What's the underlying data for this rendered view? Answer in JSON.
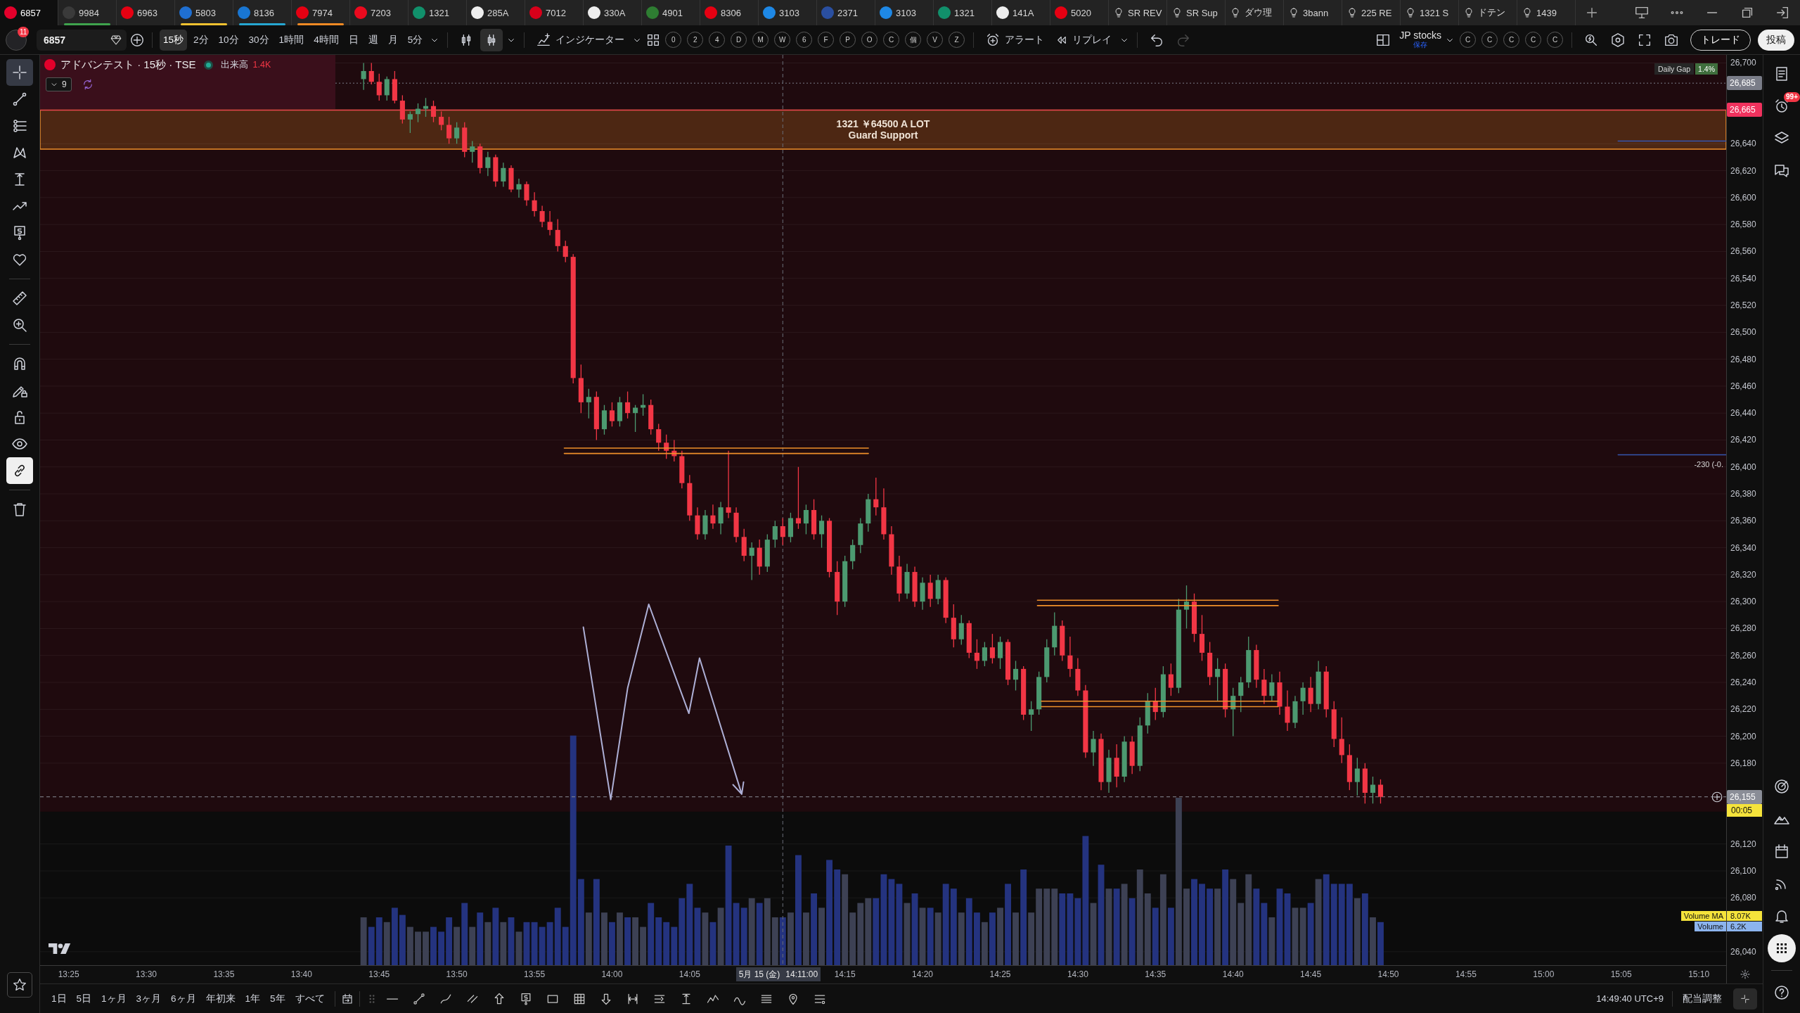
{
  "tabs": [
    {
      "label": "6857",
      "kind": "logo",
      "color": "#e4002b",
      "selected": true
    },
    {
      "label": "9984",
      "kind": "logo",
      "color": "#3a3a3a",
      "underline": {
        "color": "#3fa34d"
      },
      "selected": false
    },
    {
      "label": "6963",
      "kind": "logo",
      "color": "#e60012",
      "selected": false
    },
    {
      "label": "5803",
      "kind": "logo",
      "color": "#1f6fd1",
      "underline": {
        "color": "#f2c230"
      },
      "selected": false
    },
    {
      "label": "8136",
      "kind": "logo",
      "color": "#1976d2",
      "underline": {
        "color": "#26a6d1"
      },
      "selected": false
    },
    {
      "label": "7974",
      "kind": "logo",
      "color": "#e60012",
      "underline": {
        "color": "#f08a24"
      },
      "selected": false
    },
    {
      "label": "7203",
      "kind": "logo",
      "color": "#eb0a1e",
      "selected": false
    },
    {
      "label": "1321",
      "kind": "logo",
      "color": "#11906b",
      "selected": false
    },
    {
      "label": "285A",
      "kind": "logo",
      "color": "#eeeeee",
      "selected": false
    },
    {
      "label": "7012",
      "kind": "logo",
      "color": "#d7001a",
      "selected": false
    },
    {
      "label": "330A",
      "kind": "logo",
      "color": "#eeeeee",
      "selected": false
    },
    {
      "label": "4901",
      "kind": "logo",
      "color": "#2e7d32",
      "selected": false
    },
    {
      "label": "8306",
      "kind": "logo",
      "color": "#e60012",
      "selected": false
    },
    {
      "label": "3103",
      "kind": "logo",
      "color": "#1e88e5",
      "selected": false
    },
    {
      "label": "2371",
      "kind": "logo",
      "color": "#2a4fa0",
      "selected": false
    },
    {
      "label": "3103",
      "kind": "logo",
      "color": "#1e88e5",
      "selected": false
    },
    {
      "label": "1321",
      "kind": "logo",
      "color": "#11906b",
      "selected": false
    },
    {
      "label": "141A",
      "kind": "logo",
      "color": "#eeeeee",
      "selected": false
    },
    {
      "label": "5020",
      "kind": "logo",
      "color": "#e60012",
      "selected": false
    },
    {
      "label": "SR REV",
      "kind": "idea",
      "selected": false
    },
    {
      "label": "SR Sup",
      "kind": "idea",
      "selected": false
    },
    {
      "label": "ダウ理",
      "kind": "idea",
      "selected": false
    },
    {
      "label": "3bann",
      "kind": "idea",
      "selected": false
    },
    {
      "label": "225 RE",
      "kind": "idea",
      "selected": false
    },
    {
      "label": "1321 S",
      "kind": "idea",
      "selected": false
    },
    {
      "label": "ドテン",
      "kind": "idea",
      "selected": false
    },
    {
      "label": "1439",
      "kind": "idea",
      "selected": false
    }
  ],
  "toolbar": {
    "notifications": "11",
    "symbol": "6857",
    "intervals": [
      {
        "label": "15秒",
        "selected": true
      },
      {
        "label": "2分",
        "selected": false
      },
      {
        "label": "10分",
        "selected": false
      },
      {
        "label": "30分",
        "selected": false
      },
      {
        "label": "1時間",
        "selected": false
      },
      {
        "label": "4時間",
        "selected": false
      },
      {
        "label": "日",
        "selected": false
      },
      {
        "label": "週",
        "selected": false
      },
      {
        "label": "月",
        "selected": false
      },
      {
        "label": "5分",
        "selected": false
      }
    ],
    "chart_types": [
      {
        "kind": "bars",
        "selected": false
      },
      {
        "kind": "candles",
        "selected": true
      }
    ],
    "indicators": "インジケーター",
    "quick_buttons": [
      "0",
      "2",
      "4",
      "D",
      "M",
      "W",
      "6",
      "F",
      "P",
      "O",
      "C",
      "個",
      "V",
      "Z"
    ],
    "alert": "アラート",
    "replay": "リプレイ",
    "history": [
      {
        "kind": "undo",
        "disabled": false
      },
      {
        "kind": "redo",
        "disabled": true
      }
    ],
    "layout": {
      "name": "JP stocks",
      "status": "保存"
    },
    "layout_slots": [
      "C",
      "C",
      "C",
      "C",
      "C"
    ],
    "trade": "トレード",
    "publish": "投稿"
  },
  "left_toolbar": {
    "drawing_tools": [
      {
        "kind": "crosshair",
        "selected": true
      },
      {
        "kind": "trend-line",
        "selected": false
      },
      {
        "kind": "parallel-lines",
        "selected": false
      },
      {
        "kind": "pattern",
        "selected": false
      },
      {
        "kind": "projection",
        "selected": false
      },
      {
        "kind": "zigzag-arrow",
        "selected": false
      },
      {
        "kind": "price-note",
        "selected": false
      },
      {
        "kind": "heart",
        "selected": false
      }
    ],
    "view_tools": [
      {
        "kind": "ruler",
        "selected": false
      },
      {
        "kind": "zoom-in",
        "selected": false
      }
    ],
    "toggles": [
      {
        "kind": "magnet",
        "on": false
      },
      {
        "kind": "pencil-lock",
        "on": false
      },
      {
        "kind": "unlock",
        "on": false
      },
      {
        "kind": "eye",
        "on": false
      },
      {
        "kind": "link",
        "on": true
      }
    ],
    "actions": [
      {
        "kind": "trash"
      }
    ],
    "favorites": [
      {
        "kind": "star"
      }
    ]
  },
  "chart": {
    "legend": {
      "title": "アドバンテスト · 15秒 · TSE",
      "volume_label": "出来高",
      "volume_value": "1.4K",
      "collapse_count": "9"
    },
    "daily_gap": {
      "label": "Daily Gap",
      "value": "1.4%"
    },
    "crosshair": {
      "date": "5月 15 (金)"
    },
    "countdown": "00:05",
    "volume_legend": [
      {
        "name": "Volume MA",
        "value": "8.07K",
        "color": "#f5e33b"
      },
      {
        "name": "Volume",
        "value": "6.2K",
        "color": "#8cb4ee"
      }
    ],
    "chart_data": [
      {
        "type": "candlestick",
        "x": [
          13.7333,
          13.7417,
          13.75,
          13.7583,
          13.7667,
          13.775,
          13.7833,
          13.7917,
          13.8,
          13.8083,
          13.8167,
          13.825,
          13.8333,
          13.8417,
          13.85,
          13.8583,
          13.8667,
          13.875,
          13.8833,
          13.8917,
          13.9,
          13.9083,
          13.9167,
          13.925,
          13.9333,
          13.9417,
          13.95,
          13.9583,
          13.9667,
          13.975,
          13.9833,
          13.9917,
          14,
          14.0083,
          14.0167,
          14.025,
          14.0333,
          14.0417,
          14.05,
          14.0583,
          14.0667,
          14.075,
          14.0833,
          14.0917,
          14.1,
          14.1083,
          14.1167,
          14.125,
          14.1333,
          14.1417,
          14.15,
          14.1583,
          14.1667,
          14.175,
          14.1833,
          14.1917,
          14.2,
          14.2083,
          14.2167,
          14.225,
          14.2333,
          14.2417,
          14.25,
          14.2583,
          14.2667,
          14.275,
          14.2833,
          14.2917,
          14.3,
          14.3083,
          14.3167,
          14.325,
          14.3333,
          14.3417,
          14.35,
          14.3583,
          14.3667,
          14.375,
          14.3833,
          14.3917,
          14.4,
          14.4083,
          14.4167,
          14.425,
          14.4333,
          14.4417,
          14.45,
          14.4583,
          14.4667,
          14.475,
          14.4833,
          14.4917,
          14.5,
          14.5083,
          14.5167,
          14.525,
          14.5333,
          14.5417,
          14.55,
          14.5583,
          14.5667,
          14.575,
          14.5833,
          14.5917,
          14.6,
          14.6083,
          14.6167,
          14.625,
          14.6333,
          14.6417,
          14.65,
          14.6583,
          14.6667,
          14.675,
          14.6833,
          14.6917,
          14.7,
          14.7083,
          14.7167,
          14.725,
          14.7333,
          14.7417,
          14.75,
          14.7583,
          14.7667,
          14.775,
          14.7833,
          14.7917,
          14.8,
          14.8083,
          14.8167,
          14.825
        ],
        "ohlc": [
          [
            26688,
            26700,
            26680,
            26694
          ],
          [
            26694,
            26700,
            26684,
            26686
          ],
          [
            26686,
            26692,
            26672,
            26676
          ],
          [
            26676,
            26690,
            26672,
            26688
          ],
          [
            26688,
            26694,
            26670,
            26672
          ],
          [
            26672,
            26676,
            26655,
            26658
          ],
          [
            26658,
            26664,
            26648,
            26662
          ],
          [
            26662,
            26670,
            26656,
            26666
          ],
          [
            26666,
            26674,
            26660,
            26668
          ],
          [
            26668,
            26672,
            26656,
            26660
          ],
          [
            26660,
            26664,
            26650,
            26654
          ],
          [
            26654,
            26660,
            26640,
            26644
          ],
          [
            26644,
            26656,
            26640,
            26652
          ],
          [
            26652,
            26656,
            26630,
            26634
          ],
          [
            26634,
            26642,
            26626,
            26638
          ],
          [
            26638,
            26640,
            26618,
            26622
          ],
          [
            26622,
            26634,
            26616,
            26630
          ],
          [
            26630,
            26632,
            26608,
            26612
          ],
          [
            26612,
            26626,
            26608,
            26622
          ],
          [
            26622,
            26624,
            26604,
            26606
          ],
          [
            26606,
            26614,
            26600,
            26610
          ],
          [
            26610,
            26612,
            26594,
            26598
          ],
          [
            26598,
            26604,
            26586,
            26590
          ],
          [
            26590,
            26594,
            26578,
            26582
          ],
          [
            26582,
            26590,
            26572,
            26576
          ],
          [
            26576,
            26584,
            26560,
            26564
          ],
          [
            26564,
            26568,
            26552,
            26556
          ],
          [
            26556,
            26558,
            26462,
            26466
          ],
          [
            26466,
            26476,
            26440,
            26448
          ],
          [
            26448,
            26458,
            26436,
            26452
          ],
          [
            26452,
            26456,
            26420,
            26428
          ],
          [
            26428,
            26446,
            26424,
            26442
          ],
          [
            26442,
            26448,
            26430,
            26434
          ],
          [
            26434,
            26452,
            26430,
            26448
          ],
          [
            26448,
            26456,
            26436,
            26440
          ],
          [
            26440,
            26446,
            26426,
            26444
          ],
          [
            26444,
            26454,
            26438,
            26446
          ],
          [
            26446,
            26450,
            26424,
            26428
          ],
          [
            26428,
            26432,
            26412,
            26418
          ],
          [
            26418,
            26424,
            26406,
            26412
          ],
          [
            26412,
            26420,
            26404,
            26408
          ],
          [
            26408,
            26412,
            26384,
            26388
          ],
          [
            26388,
            26394,
            26360,
            26364
          ],
          [
            26364,
            26370,
            26346,
            26350
          ],
          [
            26350,
            26368,
            26346,
            26364
          ],
          [
            26364,
            26372,
            26354,
            26358
          ],
          [
            26358,
            26374,
            26350,
            26370
          ],
          [
            26370,
            26412,
            26362,
            26366
          ],
          [
            26366,
            26370,
            26344,
            26348
          ],
          [
            26348,
            26354,
            26330,
            26334
          ],
          [
            26334,
            26344,
            26316,
            26340
          ],
          [
            26340,
            26346,
            26320,
            26326
          ],
          [
            26326,
            26350,
            26322,
            26346
          ],
          [
            26346,
            26360,
            26340,
            26356
          ],
          [
            26356,
            26362,
            26342,
            26348
          ],
          [
            26348,
            26366,
            26344,
            26362
          ],
          [
            26362,
            26400,
            26354,
            26358
          ],
          [
            26358,
            26372,
            26350,
            26368
          ],
          [
            26368,
            26376,
            26346,
            26350
          ],
          [
            26350,
            26364,
            26340,
            26360
          ],
          [
            26360,
            26362,
            26318,
            26322
          ],
          [
            26322,
            26330,
            26290,
            26300
          ],
          [
            26300,
            26334,
            26296,
            26330
          ],
          [
            26330,
            26346,
            26324,
            26342
          ],
          [
            26342,
            26362,
            26336,
            26358
          ],
          [
            26358,
            26380,
            26352,
            26376
          ],
          [
            26376,
            26392,
            26364,
            26370
          ],
          [
            26370,
            26384,
            26346,
            26350
          ],
          [
            26350,
            26356,
            26320,
            26326
          ],
          [
            26326,
            26334,
            26300,
            26306
          ],
          [
            26306,
            26328,
            26302,
            26322
          ],
          [
            26322,
            26326,
            26296,
            26300
          ],
          [
            26300,
            26318,
            26294,
            26314
          ],
          [
            26314,
            26320,
            26296,
            26302
          ],
          [
            26302,
            26320,
            26298,
            26316
          ],
          [
            26316,
            26318,
            26284,
            26288
          ],
          [
            26288,
            26298,
            26266,
            26272
          ],
          [
            26272,
            26290,
            26268,
            26284
          ],
          [
            26284,
            26286,
            26258,
            26262
          ],
          [
            26262,
            26272,
            26250,
            26256
          ],
          [
            26256,
            26270,
            26252,
            26266
          ],
          [
            26266,
            26276,
            26254,
            26258
          ],
          [
            26258,
            26274,
            26250,
            26270
          ],
          [
            26270,
            26272,
            26238,
            26242
          ],
          [
            26242,
            26256,
            26234,
            26250
          ],
          [
            26250,
            26252,
            26212,
            26216
          ],
          [
            26216,
            26226,
            26204,
            26220
          ],
          [
            26220,
            26248,
            26216,
            26244
          ],
          [
            26244,
            26272,
            26240,
            26266
          ],
          [
            26266,
            26292,
            26260,
            26282
          ],
          [
            26282,
            26286,
            26256,
            26260
          ],
          [
            26260,
            26274,
            26244,
            26250
          ],
          [
            26250,
            26258,
            26230,
            26234
          ],
          [
            26234,
            26238,
            26184,
            26188
          ],
          [
            26188,
            26204,
            26178,
            26198
          ],
          [
            26198,
            26202,
            26160,
            26166
          ],
          [
            26166,
            26190,
            26158,
            26184
          ],
          [
            26184,
            26194,
            26162,
            26170
          ],
          [
            26170,
            26200,
            26166,
            26196
          ],
          [
            26196,
            26200,
            26172,
            26178
          ],
          [
            26178,
            26214,
            26174,
            26208
          ],
          [
            26208,
            26232,
            26202,
            26226
          ],
          [
            26226,
            26236,
            26212,
            26218
          ],
          [
            26218,
            26252,
            26214,
            26246
          ],
          [
            26246,
            26254,
            26230,
            26236
          ],
          [
            26236,
            26302,
            26232,
            26294
          ],
          [
            26294,
            26312,
            26280,
            26300
          ],
          [
            26300,
            26306,
            26270,
            26276
          ],
          [
            26276,
            26290,
            26256,
            26262
          ],
          [
            26262,
            26270,
            26238,
            26244
          ],
          [
            26244,
            26258,
            26226,
            26250
          ],
          [
            26250,
            26254,
            26214,
            26220
          ],
          [
            26220,
            26236,
            26200,
            26230
          ],
          [
            26230,
            26244,
            26218,
            26240
          ],
          [
            26240,
            26274,
            26236,
            26264
          ],
          [
            26264,
            26268,
            26236,
            26242
          ],
          [
            26242,
            26250,
            26224,
            26230
          ],
          [
            26230,
            26246,
            26226,
            26240
          ],
          [
            26240,
            26248,
            26216,
            26222
          ],
          [
            26222,
            26234,
            26204,
            26210
          ],
          [
            26210,
            26230,
            26206,
            26226
          ],
          [
            26226,
            26240,
            26216,
            26236
          ],
          [
            26236,
            26244,
            26218,
            26224
          ],
          [
            26224,
            26256,
            26220,
            26248
          ],
          [
            26248,
            26252,
            26214,
            26220
          ],
          [
            26220,
            26226,
            26192,
            26198
          ],
          [
            26198,
            26214,
            26180,
            26186
          ],
          [
            26186,
            26194,
            26160,
            26166
          ],
          [
            26166,
            26184,
            26156,
            26176
          ],
          [
            26176,
            26180,
            26150,
            26158
          ],
          [
            26158,
            26170,
            26150,
            26164
          ],
          [
            26164,
            26168,
            26150,
            26155
          ]
        ],
        "series": [
          {
            "type": "line",
            "x": [
              13.9487,
              14.2752
            ],
            "values": [
              26414,
              26414
            ],
            "color": "#f0902a"
          },
          {
            "type": "line",
            "x": [
              13.9487,
              14.2752
            ],
            "values": [
              26410,
              26410
            ],
            "color": "#f0902a"
          },
          {
            "type": "line",
            "x": [
              14.4566,
              14.7151
            ],
            "values": [
              26301,
              26301
            ],
            "color": "#f0902a"
          },
          {
            "type": "line",
            "x": [
              14.4566,
              14.7151
            ],
            "values": [
              26297,
              26297
            ],
            "color": "#f0902a"
          },
          {
            "type": "line",
            "x": [
              14.4608,
              14.7151
            ],
            "values": [
              26226,
              26226
            ],
            "color": "#f0902a"
          },
          {
            "type": "line",
            "x": [
              14.4608,
              14.7151
            ],
            "values": [
              26222,
              26222
            ],
            "color": "#f0902a"
          },
          {
            "type": "line",
            "x": [
              13.9692,
              13.9986,
              14.0168,
              14.0394,
              14.0825,
              14.0939,
              14.1392,
              14.1412,
              14.1392,
              14.1299
            ],
            "values": [
              26281,
              26153,
              26236,
              26298,
              26217,
              26258,
              26157,
              26166,
              26157,
              26164
            ],
            "color": "#aeb0d6"
          },
          {
            "type": "line",
            "x": [
              15.08,
              15.196
            ],
            "values": [
              26642,
              26642
            ],
            "color": "#3556b0"
          },
          {
            "type": "line",
            "x": [
              15.08,
              15.196
            ],
            "values": [
              26409,
              26409
            ],
            "color": "#3556b0",
            "name": "-230 (-0."
          }
        ],
        "xlim": [
          13.386,
          15.196
        ],
        "ylim": [
          26030,
          26706
        ],
        "grid": true,
        "xticks": [
          {
            "value": 13.4167,
            "label": "13:25"
          },
          {
            "value": 13.5,
            "label": "13:30"
          },
          {
            "value": 13.5833,
            "label": "13:35"
          },
          {
            "value": 13.6667,
            "label": "13:40"
          },
          {
            "value": 13.75,
            "label": "13:45"
          },
          {
            "value": 13.8333,
            "label": "13:50"
          },
          {
            "value": 13.9167,
            "label": "13:55"
          },
          {
            "value": 14,
            "label": "14:00"
          },
          {
            "value": 14.0833,
            "label": "14:05"
          },
          {
            "value": 14.25,
            "label": "14:15"
          },
          {
            "value": 14.3333,
            "label": "14:20"
          },
          {
            "value": 14.4167,
            "label": "14:25"
          },
          {
            "value": 14.5,
            "label": "14:30"
          },
          {
            "value": 14.5833,
            "label": "14:35"
          },
          {
            "value": 14.6667,
            "label": "14:40"
          },
          {
            "value": 14.75,
            "label": "14:45"
          },
          {
            "value": 14.8333,
            "label": "14:50"
          },
          {
            "value": 14.9167,
            "label": "14:55"
          },
          {
            "value": 15,
            "label": "15:00"
          },
          {
            "value": 15.0833,
            "label": "15:05"
          },
          {
            "value": 15.1667,
            "label": "15:10"
          }
        ],
        "yticks": [
          {
            "value": 26040,
            "label": "26,040"
          },
          {
            "value": 26080,
            "label": "26,080"
          },
          {
            "value": 26100,
            "label": "26,100"
          },
          {
            "value": 26120,
            "label": "26,120"
          },
          {
            "value": 26180,
            "label": "26,180"
          },
          {
            "value": 26200,
            "label": "26,200"
          },
          {
            "value": 26220,
            "label": "26,220"
          },
          {
            "value": 26240,
            "label": "26,240"
          },
          {
            "value": 26260,
            "label": "26,260"
          },
          {
            "value": 26280,
            "label": "26,280"
          },
          {
            "value": 26300,
            "label": "26,300"
          },
          {
            "value": 26320,
            "label": "26,320"
          },
          {
            "value": 26340,
            "label": "26,340"
          },
          {
            "value": 26360,
            "label": "26,360"
          },
          {
            "value": 26380,
            "label": "26,380"
          },
          {
            "value": 26400,
            "label": "26,400"
          },
          {
            "value": 26420,
            "label": "26,420"
          },
          {
            "value": 26440,
            "label": "26,440"
          },
          {
            "value": 26460,
            "label": "26,460"
          },
          {
            "value": 26480,
            "label": "26,480"
          },
          {
            "value": 26500,
            "label": "26,500"
          },
          {
            "value": 26520,
            "label": "26,520"
          },
          {
            "value": 26540,
            "label": "26,540"
          },
          {
            "value": 26560,
            "label": "26,560"
          },
          {
            "value": 26580,
            "label": "26,580"
          },
          {
            "value": 26600,
            "label": "26,600"
          },
          {
            "value": 26620,
            "label": "26,620"
          },
          {
            "value": 26640,
            "label": "26,640"
          },
          {
            "value": 26700,
            "label": "26,700"
          }
        ],
        "ref_lines": [
          {
            "axis": "y",
            "value": 26685,
            "label": "26,685",
            "color": "#7a7d88",
            "line_style": "dotted"
          },
          {
            "axis": "y",
            "value": 26665,
            "label": "26,665",
            "color": "#f0325e",
            "line_style": "solid"
          },
          {
            "axis": "y",
            "value": 26155,
            "label": "26,155",
            "color": "#8a8d97",
            "line_style": "dashed"
          },
          {
            "axis": "x",
            "value": 14.1833,
            "label": "14:11:00",
            "color": "#6a6d78",
            "line_style": "dashed"
          }
        ],
        "bands": [
          {
            "axis": "y",
            "from": 26144,
            "to": 26706,
            "color": "#1f0a0e"
          },
          {
            "axis": "y",
            "from": 26636,
            "to": 26665,
            "label": "1321 ￥64500 A LOT\nGuard Support",
            "color": "#f0902a"
          }
        ]
      }
    ]
  },
  "right_sidebar": {
    "top": [
      {
        "kind": "list",
        "selected": false
      },
      {
        "kind": "alarm-clock",
        "selected": false,
        "badge": "99+"
      },
      {
        "kind": "layers",
        "selected": false
      },
      {
        "kind": "chat",
        "selected": false
      }
    ],
    "bottom": [
      {
        "kind": "target",
        "selected": false
      },
      {
        "kind": "mountains",
        "selected": false
      },
      {
        "kind": "calendar",
        "selected": false
      },
      {
        "kind": "broadcast",
        "selected": false
      },
      {
        "kind": "bell",
        "selected": false
      },
      {
        "kind": "apps",
        "selected": true
      },
      {
        "kind": "help",
        "selected": false
      }
    ]
  },
  "bottom_bar": {
    "ranges": [
      {
        "label": "1日",
        "selected": false
      },
      {
        "label": "5日",
        "selected": false
      },
      {
        "label": "1ヶ月",
        "selected": false
      },
      {
        "label": "3ヶ月",
        "selected": false
      },
      {
        "label": "6ヶ月",
        "selected": false
      },
      {
        "label": "年初来",
        "selected": false
      },
      {
        "label": "1年",
        "selected": false
      },
      {
        "label": "5年",
        "selected": false
      },
      {
        "label": "すべて",
        "selected": false
      }
    ],
    "favorite_tools": [
      {
        "kind": "horizontal-line"
      },
      {
        "kind": "trend-line"
      },
      {
        "kind": "curve"
      },
      {
        "kind": "channel"
      },
      {
        "kind": "arrow-up"
      },
      {
        "kind": "price-note"
      },
      {
        "kind": "rectangle"
      },
      {
        "kind": "table"
      },
      {
        "kind": "arrow-down"
      },
      {
        "kind": "date-range"
      },
      {
        "kind": "long-position"
      },
      {
        "kind": "projection"
      },
      {
        "kind": "zigzag"
      },
      {
        "kind": "wave"
      },
      {
        "kind": "lines"
      },
      {
        "kind": "pin"
      },
      {
        "kind": "list-settings"
      }
    ],
    "clock": "14:49:40 UTC+9",
    "adjust": "配当調整"
  }
}
